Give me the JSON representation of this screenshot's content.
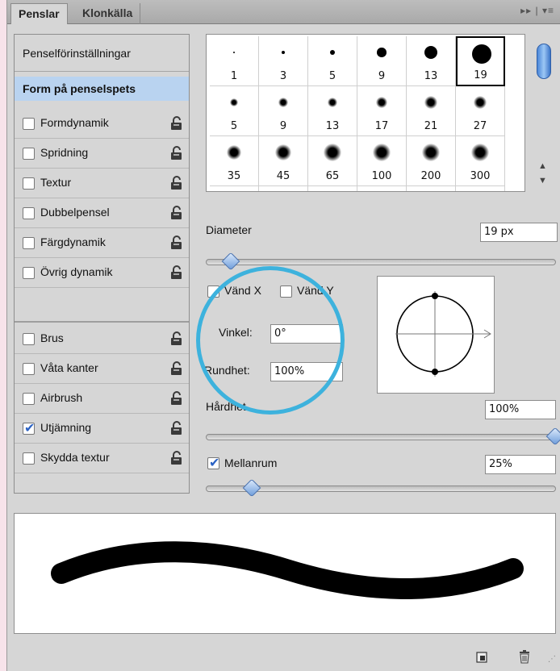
{
  "tabs": [
    {
      "label": "Penslar",
      "active": true
    },
    {
      "label": "Klonkälla",
      "active": false
    }
  ],
  "panel_menu_glyphs": "▸▸ | ▾≡",
  "sidebar": {
    "presets_label": "Penselförinställningar",
    "tip_shape_label": "Form på penselspets",
    "options": [
      {
        "label": "Formdynamik",
        "checked": false
      },
      {
        "label": "Spridning",
        "checked": false
      },
      {
        "label": "Textur",
        "checked": false
      },
      {
        "label": "Dubbelpensel",
        "checked": false
      },
      {
        "label": "Färgdynamik",
        "checked": false
      },
      {
        "label": "Övrig dynamik",
        "checked": false
      },
      {
        "label": "Brus",
        "checked": false
      },
      {
        "label": "Våta kanter",
        "checked": false
      },
      {
        "label": "Airbrush",
        "checked": false
      },
      {
        "label": "Utjämning",
        "checked": true
      },
      {
        "label": "Skydda textur",
        "checked": false
      }
    ]
  },
  "presets": {
    "selected": "19",
    "rows": [
      [
        "1",
        "3",
        "5",
        "9",
        "13",
        "19"
      ],
      [
        "5",
        "9",
        "13",
        "17",
        "21",
        "27"
      ],
      [
        "35",
        "45",
        "65",
        "100",
        "200",
        "300"
      ]
    ]
  },
  "diameter": {
    "label": "Diameter",
    "value": "19 px",
    "slider_fraction": 0.07
  },
  "flip": {
    "x_label": "Vänd X",
    "y_label": "Vänd Y",
    "x_checked": false,
    "y_checked": false
  },
  "angle": {
    "label": "Vinkel:",
    "value": "0°"
  },
  "roundness": {
    "label": "Rundhet:",
    "value": "100%"
  },
  "hardness": {
    "label": "Hårdhet",
    "value": "100%",
    "slider_fraction": 1.0
  },
  "spacing": {
    "label": "Mellanrum",
    "value": "25%",
    "checked": true,
    "slider_fraction": 0.13
  },
  "colors": {
    "highlight_ring": "#3db2dd",
    "selected_item": "#b9d3f0",
    "panel": "#d6d6d6"
  }
}
